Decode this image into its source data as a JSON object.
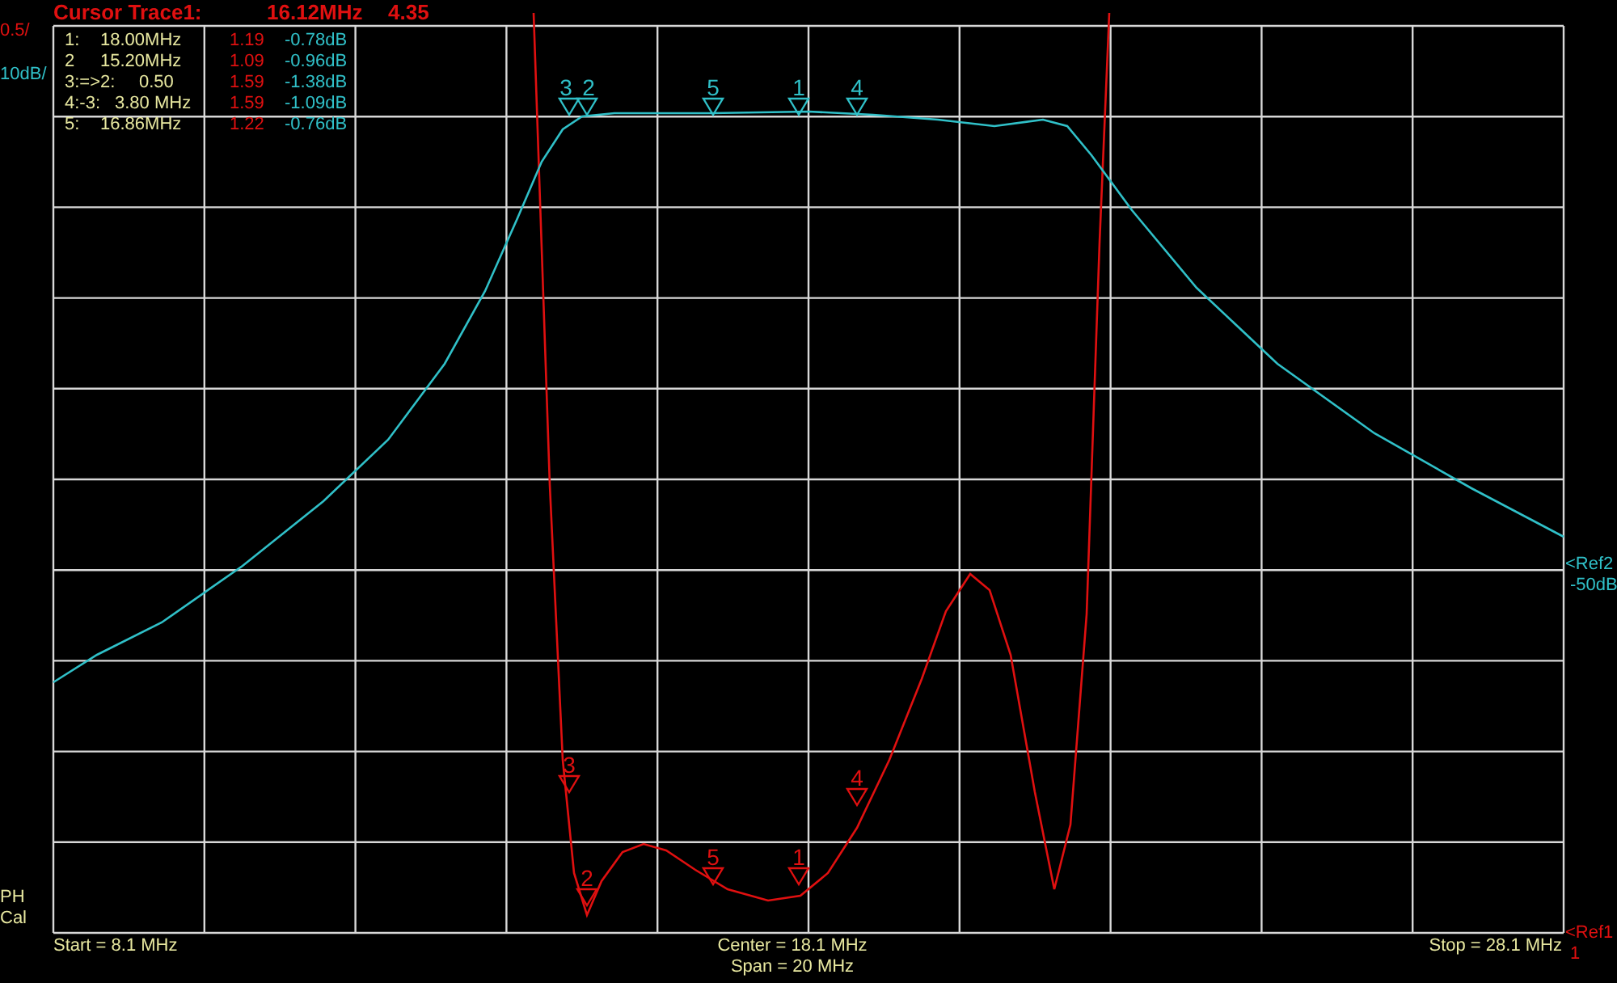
{
  "cursor": {
    "label": "Cursor Trace1:",
    "frequency": "16.12MHz",
    "value": "4.35"
  },
  "traces": [
    {
      "color": "#e01010",
      "scale": "0.5/",
      "markers": [
        "3",
        "2",
        "5",
        "1",
        "4"
      ]
    },
    {
      "color": "#30c0c8",
      "scale": "10dB/",
      "markers": [
        "3",
        "2",
        "5",
        "1",
        "4"
      ]
    }
  ],
  "references": [
    {
      "label": "<Ref2",
      "value": "-50dB",
      "color": "#30c0c8"
    },
    {
      "label": "<Ref1",
      "value": "1",
      "color": "#e01010"
    }
  ],
  "marker_table": [
    {
      "number": "1:",
      "frequency": "18.00MHz",
      "trace1_value": "1.19",
      "trace2_value": "-0.78dB"
    },
    {
      "number": "2",
      "frequency": "15.20MHz",
      "trace1_value": "1.09",
      "trace2_value": "-0.96dB"
    },
    {
      "number": "3:=>2:",
      "frequency": "0.50",
      "trace1_value": "1.59",
      "trace2_value": "-1.38dB"
    },
    {
      "number": "4:-3:",
      "frequency": "3.80 MHz",
      "trace1_value": "1.59",
      "trace2_value": "-1.09dB"
    },
    {
      "number": "5:",
      "frequency": "16.86MHz",
      "trace1_value": "1.22",
      "trace2_value": "-0.76dB"
    }
  ],
  "side_labels": [
    "PH",
    "Cal"
  ],
  "footer": {
    "start": "Start = 8.1 MHz",
    "center": "Center = 18.1 MHz",
    "span": "Span = 20 MHz",
    "stop": "Stop = 28.1 MHz"
  }
}
